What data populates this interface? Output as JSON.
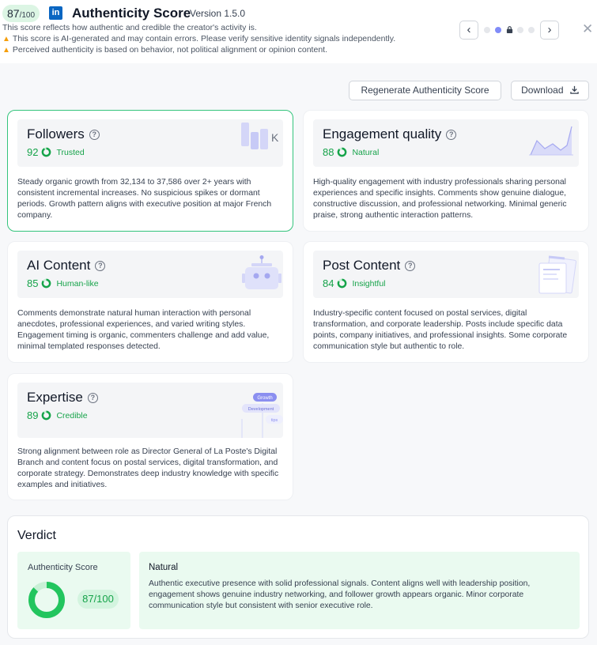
{
  "header": {
    "score": "87",
    "score_denominator": "/100",
    "title": "Authenticity Score",
    "version": "Version 1.5.0",
    "subtitle": "This score reflects how authentic and credible the creator's activity is.",
    "warnings": [
      "This score is AI-generated and may contain errors. Please verify sensitive identity signals independently.",
      "Perceived authenticity is based on behavior, not political alignment or opinion content."
    ],
    "nav": {
      "prev": "‹",
      "next": "›",
      "close": "✕"
    },
    "brand_color": "#0a66c2"
  },
  "actions": {
    "regenerate": "Regenerate Authenticity Score",
    "download": "Download"
  },
  "cards": [
    {
      "title": "Followers",
      "score": "92",
      "label": "Trusted",
      "description": "Steady organic growth from 32,134 to 37,586 over 2+ years with consistent incremental increases. No suspicious spikes or dormant periods. Growth pattern aligns with executive position at major French company.",
      "illus_text": "K"
    },
    {
      "title": "Engagement quality",
      "score": "88",
      "label": "Natural",
      "description": "High-quality engagement with industry professionals sharing personal experiences and specific insights. Comments show genuine dialogue, constructive discussion, and professional networking. Minimal generic praise, strong authentic interaction patterns."
    },
    {
      "title": "AI Content",
      "score": "85",
      "label": "Human-like",
      "description": "Comments demonstrate natural human interaction with personal anecdotes, professional experiences, and varied writing styles. Engagement timing is organic, commenters challenge and add value, minimal templated responses detected."
    },
    {
      "title": "Post Content",
      "score": "84",
      "label": "Insightful",
      "description": "Industry-specific content focused on postal services, digital transformation, and corporate leadership. Posts include specific data points, company initiatives, and professional insights. Some corporate communication style but authentic to role."
    },
    {
      "title": "Expertise",
      "score": "89",
      "label": "Credible",
      "description": "Strong alignment between role as Director General of La Poste's Digital Branch and content focus on postal services, digital transformation, and corporate strategy. Demonstrates deep industry knowledge with specific examples and initiatives.",
      "tags": [
        "Growth",
        "Development",
        "tips"
      ]
    }
  ],
  "verdict": {
    "title": "Verdict",
    "score_label": "Authenticity Score",
    "score": "87/100",
    "score_value": 87,
    "category": "Natural",
    "text": "Authentic executive presence with solid professional signals. Content aligns well with leadership position, engagement shows genuine industry networking, and follower growth appears organic. Minor corporate communication style but consistent with senior executive role."
  },
  "colors": {
    "accent_green": "#16a34a",
    "active_border": "#34c47c",
    "illus_purple": "#a5a8f0"
  }
}
